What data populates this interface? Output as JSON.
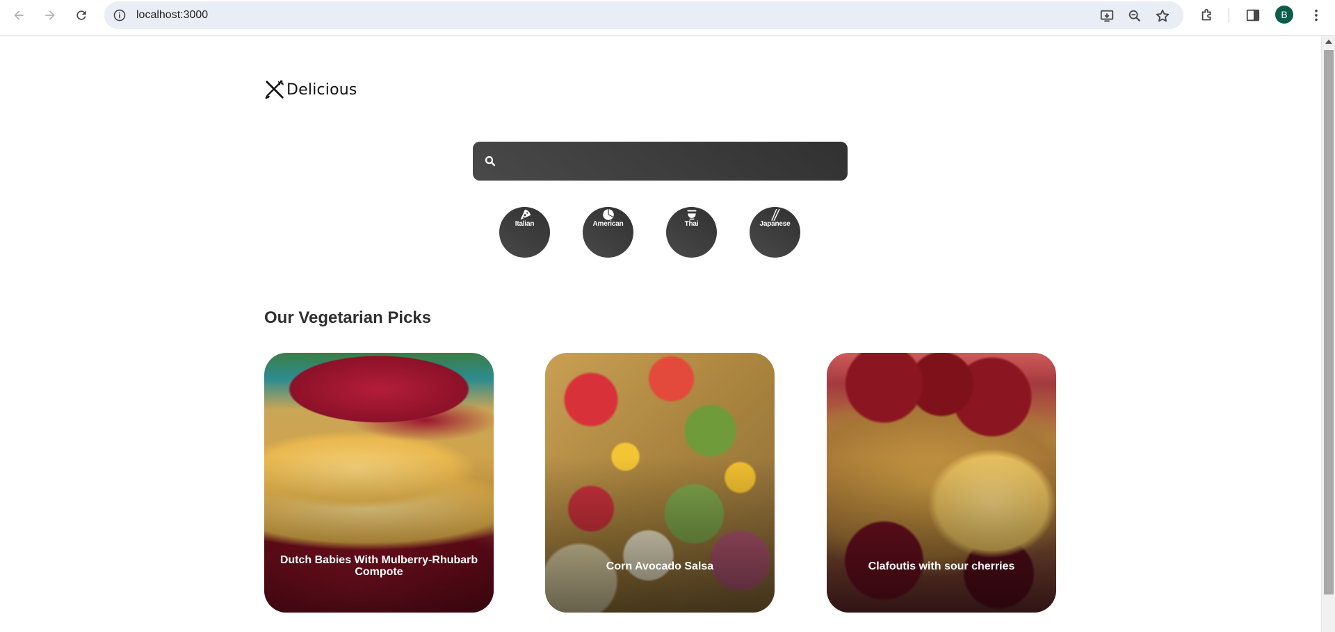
{
  "browser": {
    "url": "localhost:3000",
    "profile_initial": "B"
  },
  "page": {
    "logo_text": "Delicious",
    "search": {
      "value": "",
      "placeholder": ""
    },
    "categories": [
      {
        "label": "Italian",
        "icon": "pizza-icon"
      },
      {
        "label": "American",
        "icon": "burger-icon"
      },
      {
        "label": "Thai",
        "icon": "noodle-bowl-icon"
      },
      {
        "label": "Japanese",
        "icon": "chopsticks-icon"
      }
    ],
    "section_title": "Our Vegetarian Picks",
    "recipes": [
      {
        "title": "Dutch Babies With Mulberry-Rhubarb Compote"
      },
      {
        "title": "Corn Avocado Salsa"
      },
      {
        "title": "Clafoutis with sour cherries"
      }
    ]
  },
  "colors": {
    "accent_dark": "#313131",
    "accent_light": "#494949"
  }
}
